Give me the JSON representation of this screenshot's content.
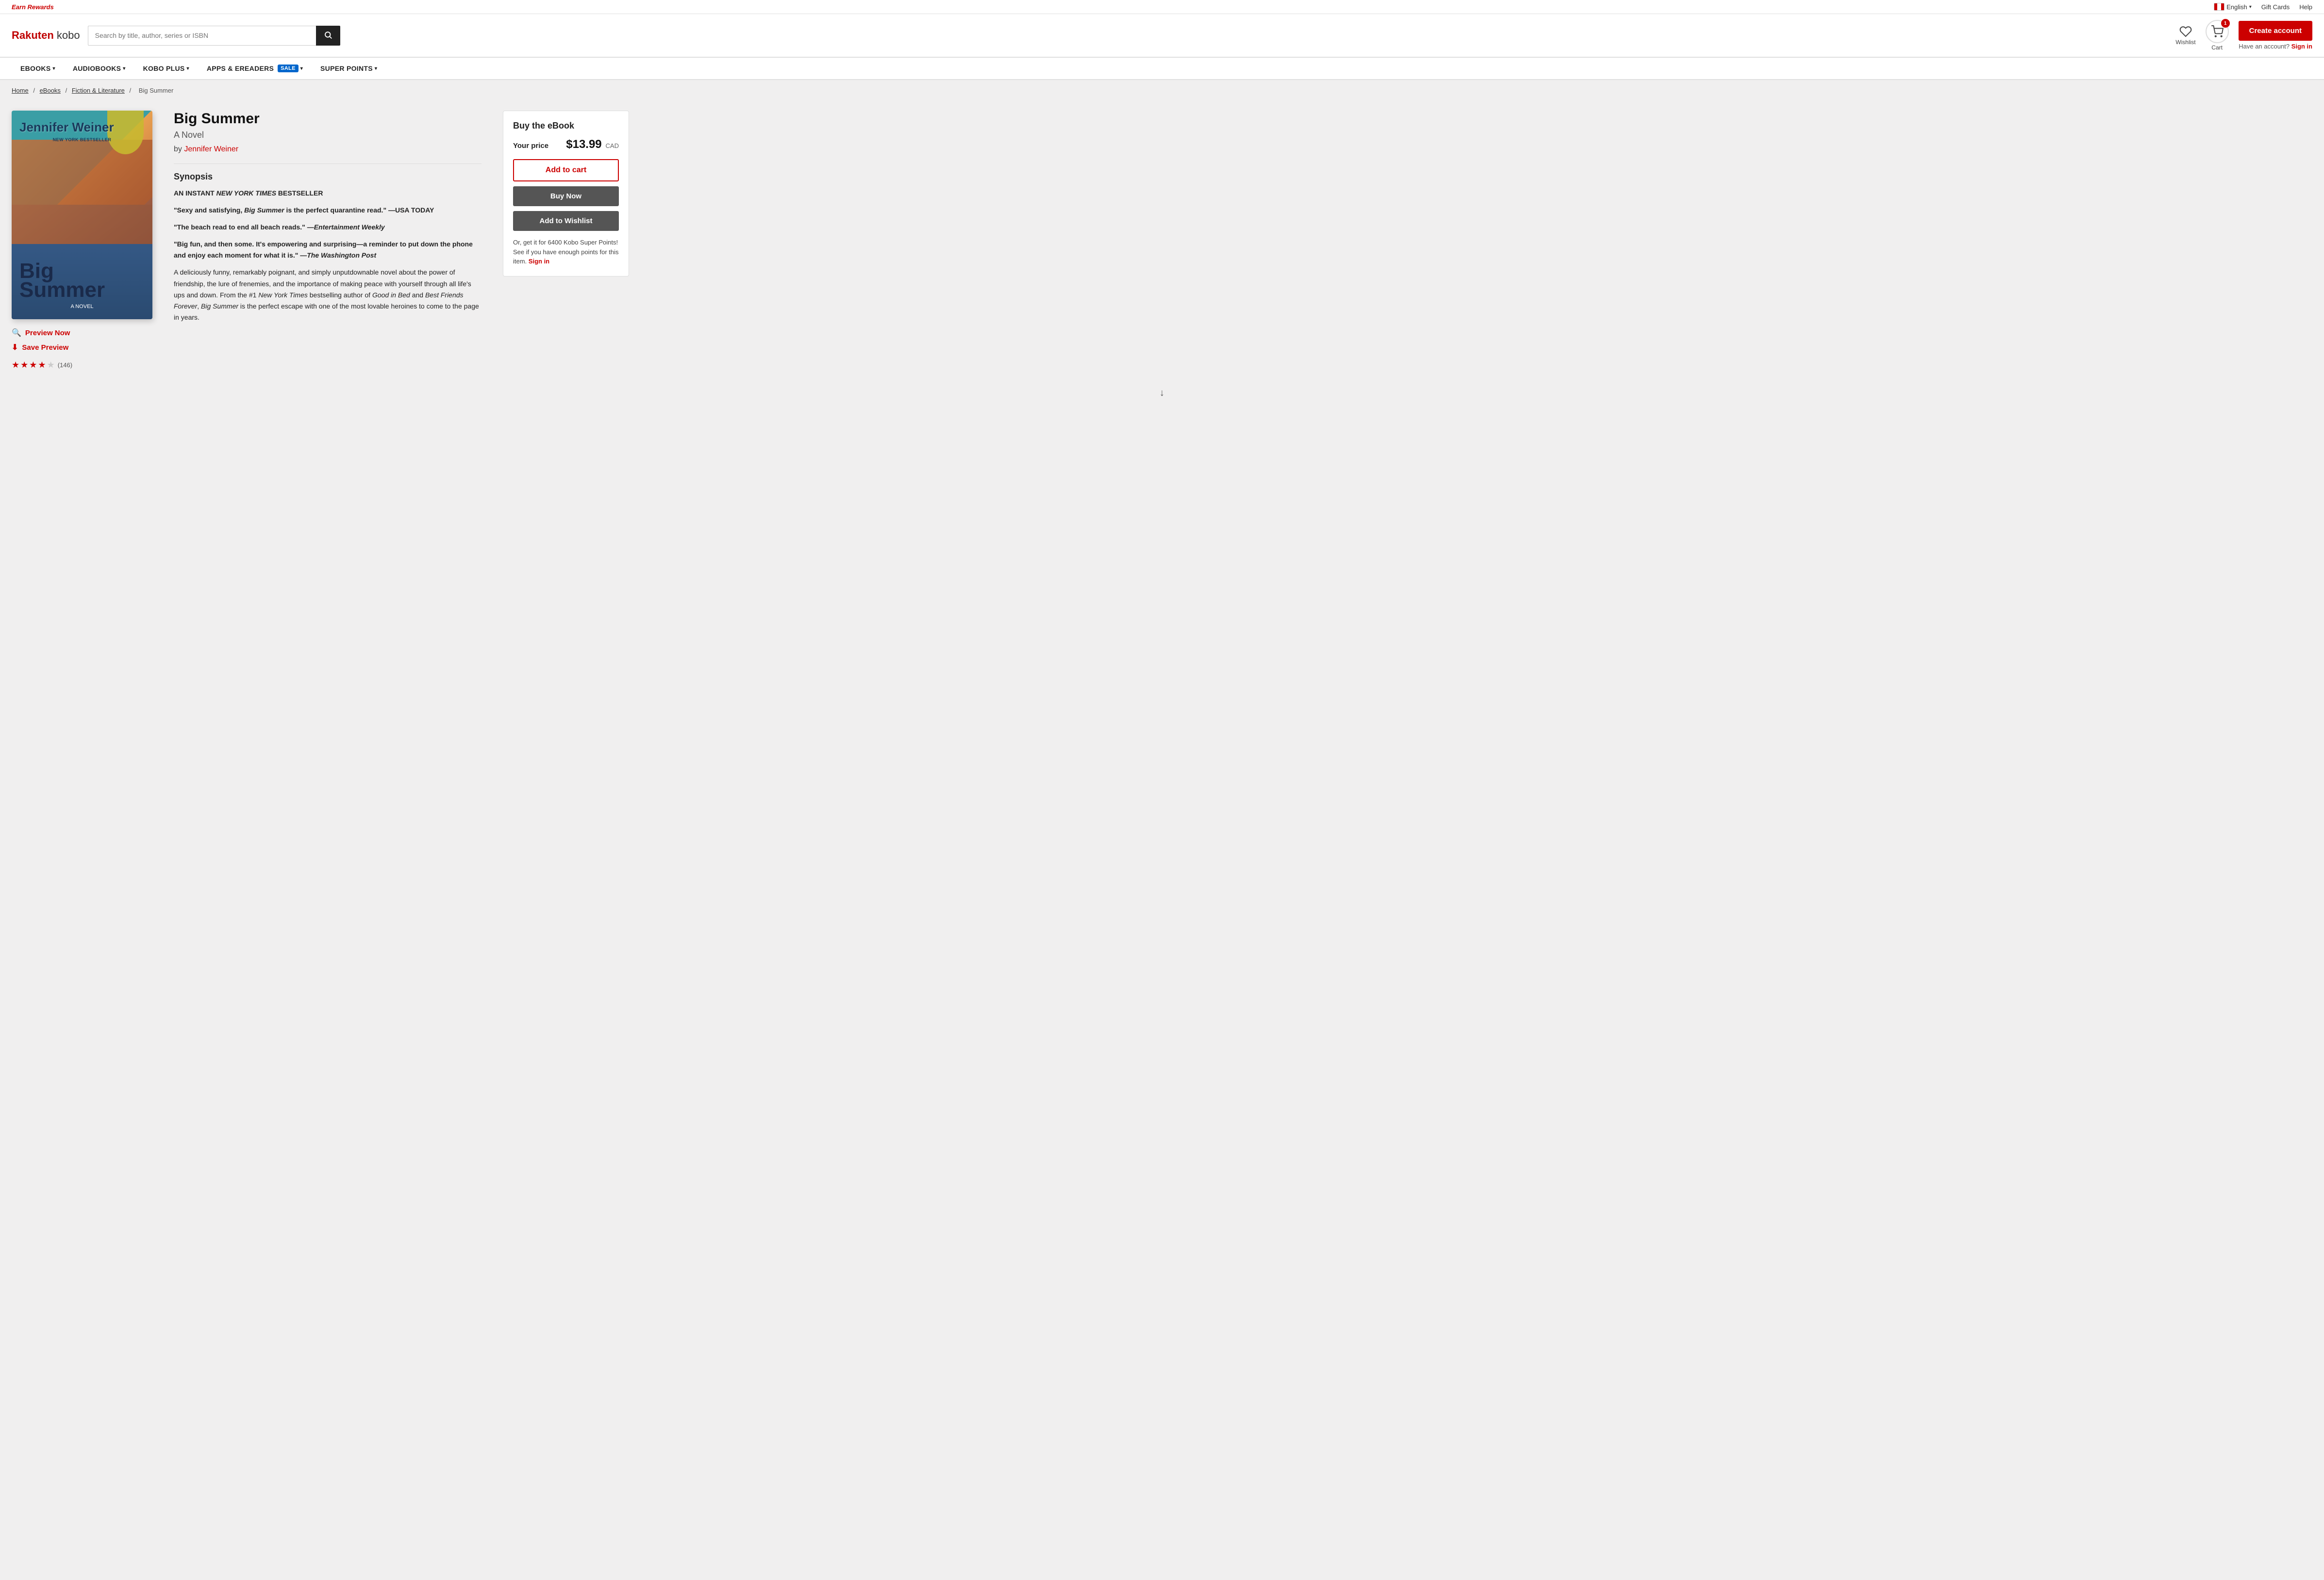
{
  "topbar": {
    "earn_rewards": "Earn Rewards",
    "language": "English",
    "gift_cards": "Gift Cards",
    "help": "Help"
  },
  "header": {
    "logo_text": "Rakuten kobo",
    "search_placeholder": "Search by title, author, series or ISBN",
    "wishlist_label": "Wishlist",
    "cart_label": "Cart",
    "cart_count": "1",
    "create_account": "Create account",
    "have_account": "Have an account?",
    "sign_in": "Sign in"
  },
  "nav": {
    "items": [
      {
        "label": "eBOOKS",
        "has_dropdown": true
      },
      {
        "label": "AUDIOBOOKS",
        "has_dropdown": true
      },
      {
        "label": "KOBO PLUS",
        "has_dropdown": true
      },
      {
        "label": "APPS & eREADERS",
        "has_dropdown": true,
        "has_sale": true
      },
      {
        "label": "SUPER POINTS",
        "has_dropdown": true
      }
    ],
    "sale_label": "SALE"
  },
  "breadcrumb": {
    "home": "Home",
    "ebooks": "eBooks",
    "fiction": "Fiction & Literature",
    "current": "Big Summer"
  },
  "book": {
    "title": "Big Summer",
    "subtitle": "A Novel",
    "author": "Jennifer Weiner",
    "cover": {
      "author_text": "Jennifer Weiner",
      "nyt_text": "New York BESTSELLER",
      "title_text": "Big Summer",
      "novel_text": "A NOVEL"
    },
    "synopsis_heading": "Synopsis",
    "synopsis_lines": [
      "AN INSTANT NEW YORK TIMES BESTSELLER",
      "\"Sexy and satisfying, Big Summer is the perfect quarantine read.\" —USA TODAY",
      "\"The beach read to end all beach reads.\" —Entertainment Weekly",
      "\"Big fun, and then some. It's empowering and surprising—a reminder to put down the phone and enjoy each moment for what it is.\" —The Washington Post",
      "A deliciously funny, remarkably poignant, and simply unputdownable novel about the power of friendship, the lure of frenemies, and the importance of making peace with yourself through all life's ups and down. From the #1 New York Times bestselling author of Good in Bed and Best Friends Forever, Big Summer is the perfect escape with one of the most lovable heroines to come to the page in years."
    ],
    "preview_label": "Preview Now",
    "save_preview_label": "Save Preview",
    "rating_value": "3.5",
    "rating_count": "(146)"
  },
  "buy": {
    "title": "Buy the eBook",
    "price_label": "Your price",
    "price": "$13.99",
    "currency": "CAD",
    "add_to_cart": "Add to cart",
    "buy_now": "Buy Now",
    "add_to_wishlist": "Add to Wishlist",
    "kobo_points_line1": "Or, get it for 6400 Kobo Super Points!",
    "kobo_points_line2": "See if you have enough points for this item.",
    "sign_in": "Sign in"
  }
}
